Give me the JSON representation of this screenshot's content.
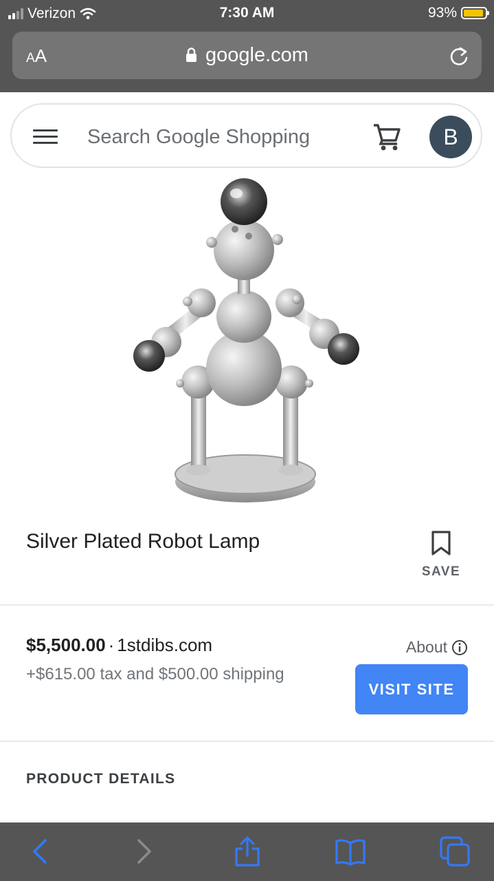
{
  "status_bar": {
    "carrier": "Verizon",
    "time": "7:30 AM",
    "battery_percent": "93%",
    "battery_level": 0.93
  },
  "browser": {
    "text_size_label": {
      "small": "A",
      "large": "A"
    },
    "url": "google.com"
  },
  "search": {
    "placeholder": "Search Google Shopping",
    "value": "",
    "avatar_initial": "B"
  },
  "product": {
    "title": "Silver Plated Robot Lamp",
    "save_label": "SAVE",
    "price": "$5,500.00",
    "separator": "·",
    "seller": "1stdibs.com",
    "tax_shipping": "+$615.00 tax and $500.00 shipping",
    "about_label": "About",
    "visit_label": "VISIT SITE"
  },
  "sections": {
    "details_heading": "PRODUCT DETAILS"
  },
  "icons": {
    "status": [
      "signal-icon",
      "wifi-icon",
      "battery-icon"
    ],
    "browser": [
      "lock-icon",
      "reload-icon"
    ],
    "search": [
      "menu-icon",
      "cart-icon"
    ],
    "product": [
      "bookmark-icon",
      "info-icon"
    ],
    "toolbar": [
      "back-icon",
      "forward-icon",
      "share-icon",
      "bookmarks-icon",
      "tabs-icon"
    ]
  },
  "colors": {
    "chrome": "#555555",
    "url_bar": "#757575",
    "accent": "#4285f4",
    "toolbar_active": "#3478f6",
    "toolbar_disabled": "#8a8a8a",
    "battery": "#f5c400",
    "avatar": "#3b4d5c"
  }
}
